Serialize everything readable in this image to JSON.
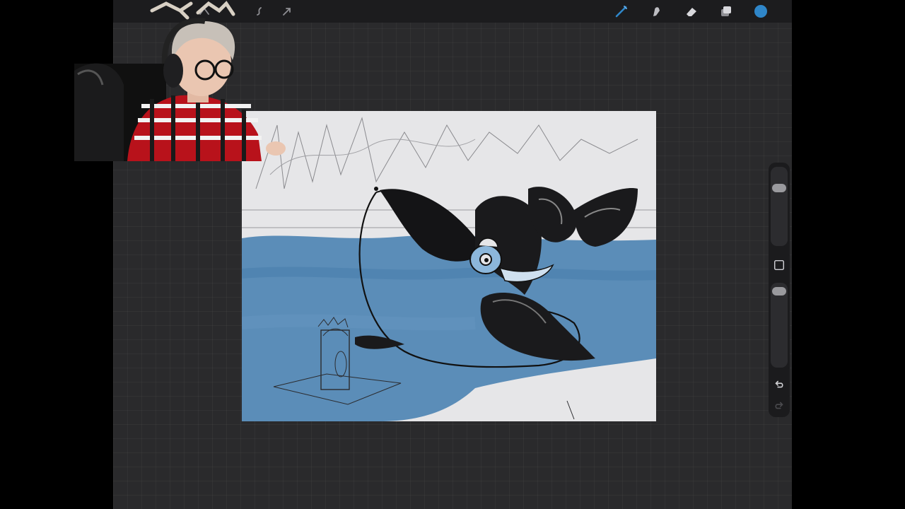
{
  "toolbar": {
    "left_tools": [
      {
        "name": "adjustments-icon"
      },
      {
        "name": "selection-icon"
      },
      {
        "name": "transform-icon"
      }
    ],
    "right_tools": [
      {
        "name": "brush-icon",
        "active": true
      },
      {
        "name": "smudge-icon"
      },
      {
        "name": "eraser-icon"
      },
      {
        "name": "layers-icon"
      },
      {
        "name": "color-swatch"
      }
    ],
    "active_color": "#2f86c9",
    "accent": "#2f86c9"
  },
  "sidebar": {
    "brush_size_level": 0.1,
    "brush_opacity_level": 0.05,
    "buttons": [
      {
        "name": "modify-square-icon"
      },
      {
        "name": "undo-icon"
      },
      {
        "name": "redo-icon"
      }
    ]
  },
  "canvas": {
    "background": "#e6e6e8",
    "water_color": "#4f86b3"
  },
  "webcam": {
    "present": true
  }
}
